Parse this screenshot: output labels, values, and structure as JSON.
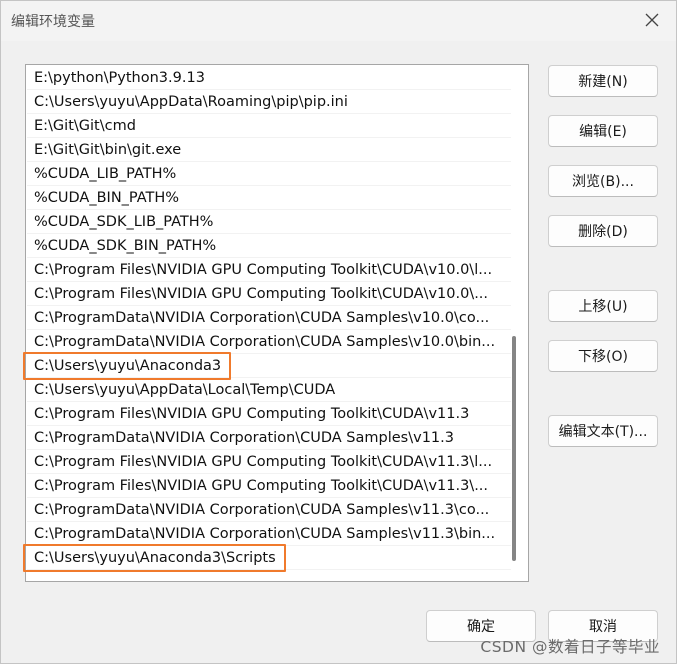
{
  "window": {
    "title": "编辑环境变量"
  },
  "icons": {
    "close": "close-icon"
  },
  "entries": [
    "E:\\python\\Python3.9.13",
    "C:\\Users\\yuyu\\AppData\\Roaming\\pip\\pip.ini",
    "E:\\Git\\Git\\cmd",
    "E:\\Git\\Git\\bin\\git.exe",
    "%CUDA_LIB_PATH%",
    "%CUDA_BIN_PATH%",
    "%CUDA_SDK_LIB_PATH%",
    "%CUDA_SDK_BIN_PATH%",
    "C:\\Program Files\\NVIDIA GPU Computing Toolkit\\CUDA\\v10.0\\l...",
    "C:\\Program Files\\NVIDIA GPU Computing Toolkit\\CUDA\\v10.0\\...",
    "C:\\ProgramData\\NVIDIA Corporation\\CUDA Samples\\v10.0\\co...",
    "C:\\ProgramData\\NVIDIA Corporation\\CUDA Samples\\v10.0\\bin...",
    "C:\\Users\\yuyu\\Anaconda3",
    "C:\\Users\\yuyu\\AppData\\Local\\Temp\\CUDA",
    "C:\\Program Files\\NVIDIA GPU Computing Toolkit\\CUDA\\v11.3",
    "C:\\ProgramData\\NVIDIA Corporation\\CUDA Samples\\v11.3",
    "C:\\Program Files\\NVIDIA GPU Computing Toolkit\\CUDA\\v11.3\\l...",
    "C:\\Program Files\\NVIDIA GPU Computing Toolkit\\CUDA\\v11.3\\...",
    "C:\\ProgramData\\NVIDIA Corporation\\CUDA Samples\\v11.3\\co...",
    "C:\\ProgramData\\NVIDIA Corporation\\CUDA Samples\\v11.3\\bin...",
    "C:\\Users\\yuyu\\Anaconda3\\Scripts"
  ],
  "highlighted_rows": [
    12,
    20
  ],
  "highlight_color": "#f07a2c",
  "buttons": {
    "new": "新建(N)",
    "edit": "编辑(E)",
    "browse": "浏览(B)...",
    "delete": "删除(D)",
    "move_up": "上移(U)",
    "move_down": "下移(O)",
    "edit_text": "编辑文本(T)...",
    "ok": "确定",
    "cancel": "取消"
  },
  "watermark": "CSDN @数着日子等毕业"
}
